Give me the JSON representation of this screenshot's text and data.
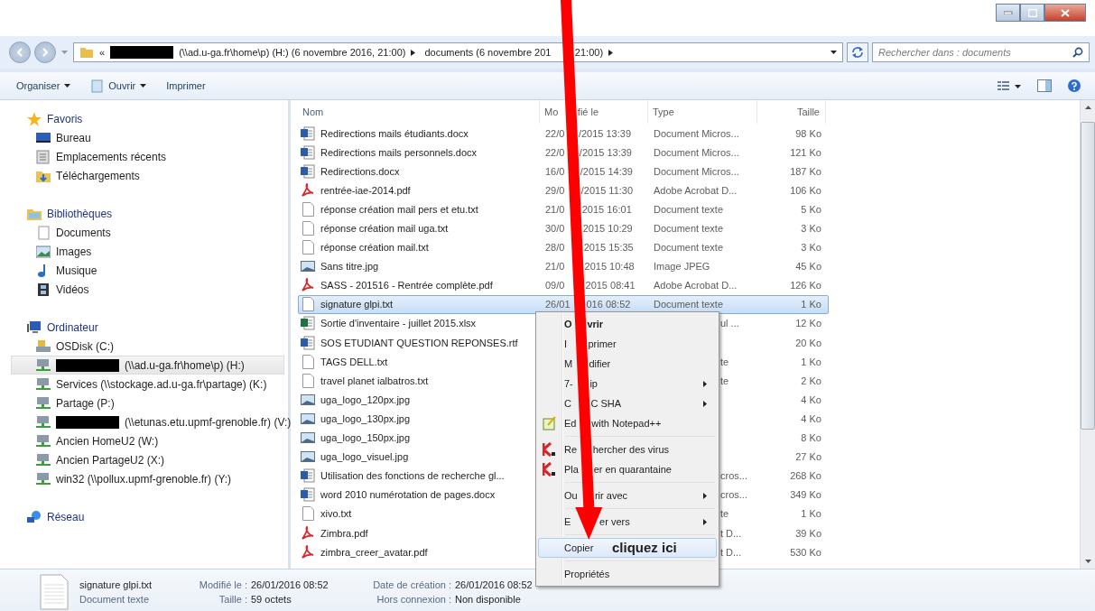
{
  "address_bar": {
    "overflow": "«",
    "segments": [
      {
        "parts": [
          "(\\\\ad.u-ga.fr\\home\\p) (H:) (6 novembre 2016, 21:00)"
        ],
        "redacted": true
      },
      {
        "parts": [
          "documents (6 novembre 201",
          "21:00)"
        ],
        "redacted": false
      }
    ]
  },
  "search": {
    "placeholder": "Rechercher dans : documents"
  },
  "toolbar": [
    {
      "label": "Organiser",
      "dropdown": true,
      "icon": false
    },
    {
      "label": "Ouvrir",
      "dropdown": true,
      "icon": true
    },
    {
      "label": "Imprimer",
      "dropdown": false,
      "icon": false
    }
  ],
  "sidebar": [
    {
      "label": "Favoris",
      "kind": "star",
      "children": [
        {
          "label": "Bureau",
          "kind": "desktop",
          "selected": false,
          "redacted": false
        },
        {
          "label": "Emplacements récents",
          "kind": "recent",
          "selected": false,
          "redacted": false
        },
        {
          "label": "Téléchargements",
          "kind": "downloads",
          "selected": false,
          "redacted": false
        }
      ]
    },
    {
      "label": "Bibliothèques",
      "kind": "library",
      "children": [
        {
          "label": "Documents",
          "kind": "page",
          "selected": false,
          "redacted": false
        },
        {
          "label": "Images",
          "kind": "image",
          "selected": false,
          "redacted": false
        },
        {
          "label": "Musique",
          "kind": "music",
          "selected": false,
          "redacted": false
        },
        {
          "label": "Vidéos",
          "kind": "video",
          "selected": false,
          "redacted": false
        }
      ]
    },
    {
      "label": "Ordinateur",
      "kind": "computer",
      "children": [
        {
          "label": "OSDisk (C:)",
          "kind": "disk",
          "selected": false,
          "redacted": false
        },
        {
          "label": "(\\\\ad.u-ga.fr\\home\\p) (H:)",
          "kind": "netdrive",
          "selected": true,
          "redacted": true
        },
        {
          "label": "Services (\\\\stockage.ad.u-ga.fr\\partage) (K:)",
          "kind": "netdrive",
          "selected": false,
          "redacted": false
        },
        {
          "label": "Partage (P:)",
          "kind": "netdrive",
          "selected": false,
          "redacted": false
        },
        {
          "label": "(\\\\etunas.etu.upmf-grenoble.fr) (V:)",
          "kind": "netdrive",
          "selected": false,
          "redacted": true
        },
        {
          "label": "Ancien HomeU2 (W:)",
          "kind": "netdrive",
          "selected": false,
          "redacted": false
        },
        {
          "label": "Ancien PartageU2 (X:)",
          "kind": "netdrive",
          "selected": false,
          "redacted": false
        },
        {
          "label": "win32 (\\\\pollux.upmf-grenoble.fr) (Y:)",
          "kind": "netdrive",
          "selected": false,
          "redacted": false
        }
      ]
    },
    {
      "label": "Réseau",
      "kind": "network"
    }
  ],
  "columns": [
    {
      "parts": [
        "Nom"
      ]
    },
    {
      "parts": [
        "Mo",
        "fié le"
      ]
    },
    {
      "parts": [
        "Type"
      ]
    },
    {
      "parts": [
        "Taille"
      ]
    }
  ],
  "rows": [
    {
      "name": "Redirections mails étudiants.docx",
      "kind": "word",
      "date": [
        "22/0",
        "/2015 13:39"
      ],
      "type": "Document Micros...",
      "size": "98 Ko",
      "selected": false
    },
    {
      "name": "Redirections mails personnels.docx",
      "kind": "word",
      "date": [
        "22/0",
        "/2015 13:39"
      ],
      "type": "Document Micros...",
      "size": "121 Ko",
      "selected": false
    },
    {
      "name": "Redirections.docx",
      "kind": "word",
      "date": [
        "16/0",
        "/2015 14:39"
      ],
      "type": "Document Micros...",
      "size": "187 Ko",
      "selected": false
    },
    {
      "name": "rentrée-iae-2014.pdf",
      "kind": "pdf",
      "date": [
        "29/0",
        "/2015 11:30"
      ],
      "type": "Adobe Acrobat D...",
      "size": "106 Ko",
      "selected": false
    },
    {
      "name": "réponse création mail pers et etu.txt",
      "kind": "text",
      "date": [
        "21/0",
        "2015 16:01"
      ],
      "type": "Document texte",
      "size": "5 Ko",
      "selected": false
    },
    {
      "name": "réponse création mail uga.txt",
      "kind": "text",
      "date": [
        "30/0",
        "2015 10:29"
      ],
      "type": "Document texte",
      "size": "3 Ko",
      "selected": false
    },
    {
      "name": "réponse création mail.txt",
      "kind": "text",
      "date": [
        "28/0",
        "2015 15:35"
      ],
      "type": "Document texte",
      "size": "3 Ko",
      "selected": false
    },
    {
      "name": "Sans titre.jpg",
      "kind": "image",
      "date": [
        "21/0",
        "2015 10:48"
      ],
      "type": "Image JPEG",
      "size": "45 Ko",
      "selected": false
    },
    {
      "name": "SASS - 201516 - Rentrée complète.pdf",
      "kind": "pdf",
      "date": [
        "09/0",
        "2015 08:41"
      ],
      "type": "Adobe Acrobat D...",
      "size": "126 Ko",
      "selected": false
    },
    {
      "name": "signature glpi.txt",
      "kind": "text",
      "date": [
        "26/01",
        "016 08:52"
      ],
      "type": "Document texte",
      "size": "1 Ko",
      "selected": true
    },
    {
      "name": "Sortie d'inventaire - juillet 2015.xlsx",
      "kind": "excel",
      "type": "ul ...",
      "size": "12 Ko",
      "selected": false
    },
    {
      "name": "SOS ETUDIANT QUESTION REPONSES.rtf",
      "kind": "word",
      "size": "20 Ko",
      "selected": false
    },
    {
      "name": "TAGS DELL.txt",
      "kind": "text",
      "type": "te",
      "size": "1 Ko",
      "selected": false
    },
    {
      "name": "travel planet ialbatros.txt",
      "kind": "text",
      "type": "te",
      "size": "2 Ko",
      "selected": false
    },
    {
      "name": "uga_logo_120px.jpg",
      "kind": "image",
      "size": "4 Ko",
      "selected": false
    },
    {
      "name": "uga_logo_130px.jpg",
      "kind": "image",
      "size": "4 Ko",
      "selected": false
    },
    {
      "name": "uga_logo_150px.jpg",
      "kind": "image",
      "size": "8 Ko",
      "selected": false
    },
    {
      "name": "uga_logo_visuel.jpg",
      "kind": "image",
      "size": "27 Ko",
      "selected": false
    },
    {
      "name": "Utilisation des fonctions de recherche gl...",
      "kind": "word",
      "type": "cros...",
      "size": "268 Ko",
      "selected": false
    },
    {
      "name": "word 2010 numérotation de pages.docx",
      "kind": "word",
      "type": "cros...",
      "size": "349 Ko",
      "selected": false
    },
    {
      "name": "xivo.txt",
      "kind": "text",
      "type": "te",
      "size": "1 Ko",
      "selected": false
    },
    {
      "name": "Zimbra.pdf",
      "kind": "pdf",
      "type": "t D...",
      "size": "39 Ko",
      "selected": false
    },
    {
      "name": "zimbra_creer_avatar.pdf",
      "kind": "pdf",
      "type": "t D...",
      "size": "530 Ko",
      "selected": false
    }
  ],
  "context_menu": [
    {
      "kind": "item",
      "parts": [
        "O",
        "vrir"
      ],
      "bold": true,
      "submenu": false,
      "selected": false
    },
    {
      "kind": "item",
      "parts": [
        "I",
        "primer"
      ],
      "bold": false,
      "submenu": false,
      "selected": false
    },
    {
      "kind": "item",
      "parts": [
        "M",
        "difier"
      ],
      "bold": false,
      "submenu": false,
      "selected": false
    },
    {
      "kind": "item",
      "parts": [
        "7-",
        "ip"
      ],
      "bold": false,
      "submenu": true,
      "selected": false
    },
    {
      "kind": "item",
      "parts": [
        "C",
        "C SHA"
      ],
      "bold": false,
      "submenu": true,
      "selected": false
    },
    {
      "kind": "notepad",
      "parts": [
        "Ed",
        "with Notepad++"
      ],
      "bold": false,
      "submenu": false,
      "selected": false
    },
    {
      "kind": "separator"
    },
    {
      "kind": "antivirus",
      "parts": [
        "Re",
        "hercher des virus"
      ],
      "bold": false,
      "submenu": false,
      "selected": false
    },
    {
      "kind": "antivirus",
      "parts": [
        "Pla",
        "er en quarantaine"
      ],
      "bold": false,
      "submenu": false,
      "selected": false
    },
    {
      "kind": "separator"
    },
    {
      "kind": "item",
      "parts": [
        "Ou",
        "rir avec"
      ],
      "bold": false,
      "submenu": true,
      "selected": false
    },
    {
      "kind": "separator"
    },
    {
      "kind": "item",
      "parts": [
        "E",
        "er vers"
      ],
      "bold": false,
      "submenu": true,
      "selected": false
    },
    {
      "kind": "separator"
    },
    {
      "kind": "item",
      "parts": [
        "Copier"
      ],
      "bold": false,
      "submenu": false,
      "selected": true
    },
    {
      "kind": "separator"
    },
    {
      "kind": "item",
      "parts": [
        "Propriétés"
      ],
      "bold": false,
      "submenu": false,
      "selected": false
    }
  ],
  "annotation": {
    "text": "cliquez ici"
  },
  "details": {
    "name": "signature glpi.txt",
    "type": "Document texte",
    "fields": [
      {
        "label": "Modifié le :",
        "value": "26/01/2016 08:52"
      },
      {
        "label": "Date de création :",
        "value": "26/01/2016 08:52"
      },
      {
        "label": "Taille :",
        "value": "59 octets"
      },
      {
        "label": "Hors connexion :",
        "value": "Non disponible"
      }
    ]
  }
}
